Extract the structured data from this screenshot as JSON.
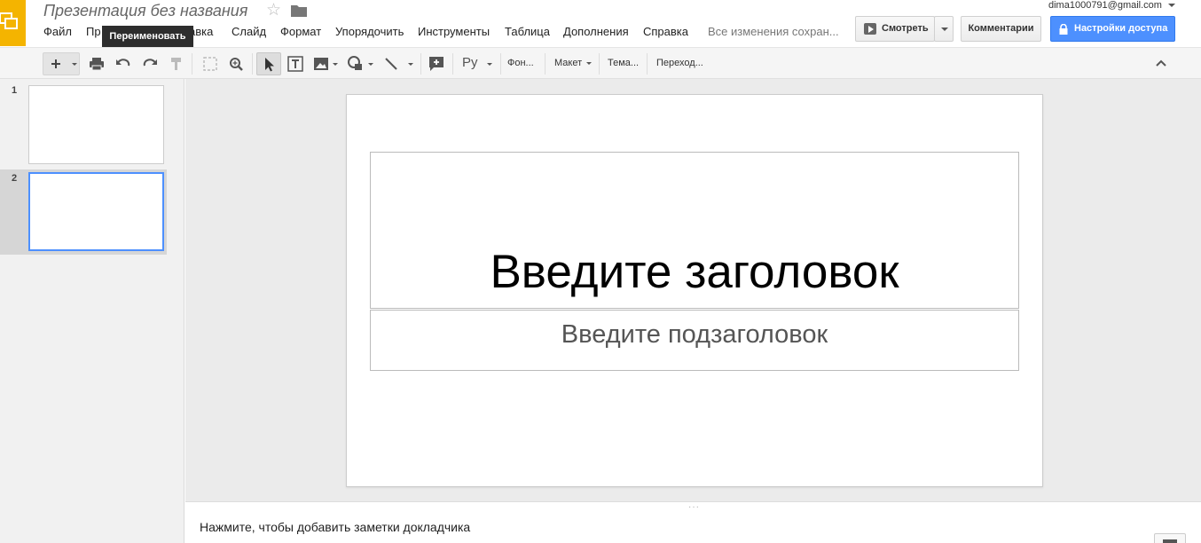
{
  "header": {
    "doc_title": "Презентация без названия",
    "account_email": "dima1000791@gmail.com",
    "save_status": "Все изменения сохран...",
    "tooltip": "Переименовать"
  },
  "menu": [
    {
      "label": "Файл"
    },
    {
      "label": "Пр"
    },
    {
      "label": "авка"
    },
    {
      "label": "Слайд"
    },
    {
      "label": "Формат"
    },
    {
      "label": "Упорядочить"
    },
    {
      "label": "Инструменты"
    },
    {
      "label": "Таблица"
    },
    {
      "label": "Дополнения"
    },
    {
      "label": "Справка"
    }
  ],
  "actions": {
    "present": "Смотреть",
    "comments": "Комментарии",
    "share": "Настройки доступа"
  },
  "toolbar": {
    "input_tools": "Ру",
    "background": "Фон...",
    "layout": "Макет",
    "theme": "Тема...",
    "transition": "Переход..."
  },
  "slides": [
    {
      "number": "1"
    },
    {
      "number": "2"
    }
  ],
  "slide": {
    "title_placeholder": "Введите заголовок",
    "subtitle_placeholder": "Введите подзаголовок"
  },
  "notes": {
    "placeholder": "Нажмите, чтобы добавить заметки докладчика"
  },
  "colors": {
    "brand": "#f4b400",
    "share_button": "#4d90fe",
    "selected_slide_border": "#4d90fe"
  },
  "icons": [
    "slides-logo-icon",
    "star-icon",
    "folder-icon",
    "play-icon",
    "lock-icon",
    "plus-icon",
    "print-icon",
    "undo-icon",
    "redo-icon",
    "paint-format-icon",
    "fit-icon",
    "zoom-icon",
    "select-cursor-icon",
    "text-box-icon",
    "image-icon",
    "shape-icon",
    "line-icon",
    "add-comment-icon",
    "collapse-chevron-icon"
  ]
}
